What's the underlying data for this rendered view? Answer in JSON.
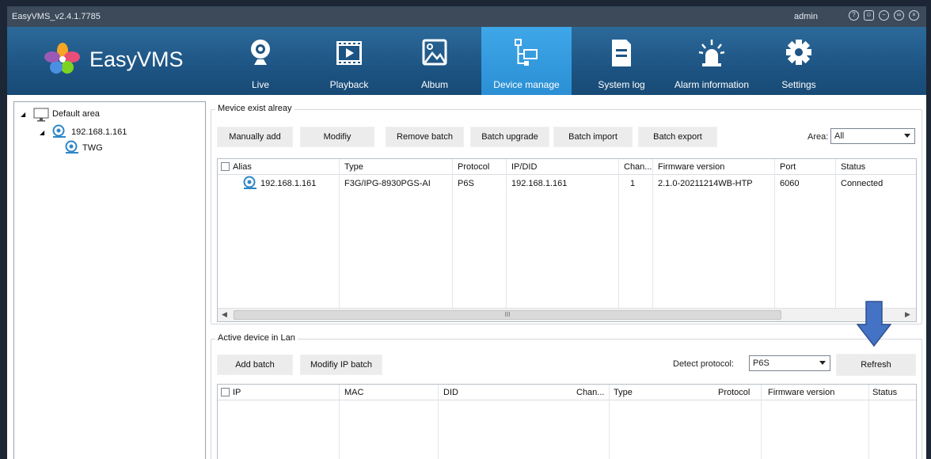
{
  "window": {
    "title": "EasyVMS_v2.4.1.7785",
    "user": "admin"
  },
  "brand": {
    "name": "EasyVMS"
  },
  "nav": {
    "live": "Live",
    "playback": "Playback",
    "album": "Album",
    "device_manage": "Device manage",
    "system_log": "System log",
    "alarm_information": "Alarm information",
    "settings": "Settings",
    "active": "device_manage"
  },
  "tree": {
    "root": "Default area",
    "device": "192.168.1.161",
    "channel": "TWG"
  },
  "existing": {
    "group_title": "Mevice exist alreay",
    "buttons": {
      "manually_add": "Manually add",
      "modify": "Modifiy",
      "remove_batch": "Remove batch",
      "batch_upgrade": "Batch upgrade",
      "batch_import": "Batch import",
      "batch_export": "Batch export"
    },
    "area_label": "Area:",
    "area_value": "All",
    "columns": [
      "Alias",
      "Type",
      "Protocol",
      "IP/DID",
      "Chan...",
      "Firmware version",
      "Port",
      "Status"
    ],
    "rows": [
      {
        "alias": "192.168.1.161",
        "type": "F3G/IPG-8930PGS-AI",
        "protocol": "P6S",
        "ip": "192.168.1.161",
        "chan": "1",
        "firmware": "2.1.0-20211214WB-HTP",
        "port": "6060",
        "status": "Connected"
      }
    ],
    "scroll_grip": "III"
  },
  "lan": {
    "group_title": "Active device in Lan",
    "buttons": {
      "add_batch": "Add batch",
      "modify_ip_batch": "Modifiy IP batch",
      "refresh": "Refresh"
    },
    "detect_label": "Detect protocol:",
    "detect_value": "P6S",
    "columns": [
      "IP",
      "MAC",
      "DID",
      "Chan...",
      "Type",
      "Protocol",
      "Firmware version",
      "Status"
    ]
  },
  "colors": {
    "ribbon": "#1d5483",
    "active_tab": "#3ea7e8",
    "annotation_arrow": "#4472c4"
  }
}
